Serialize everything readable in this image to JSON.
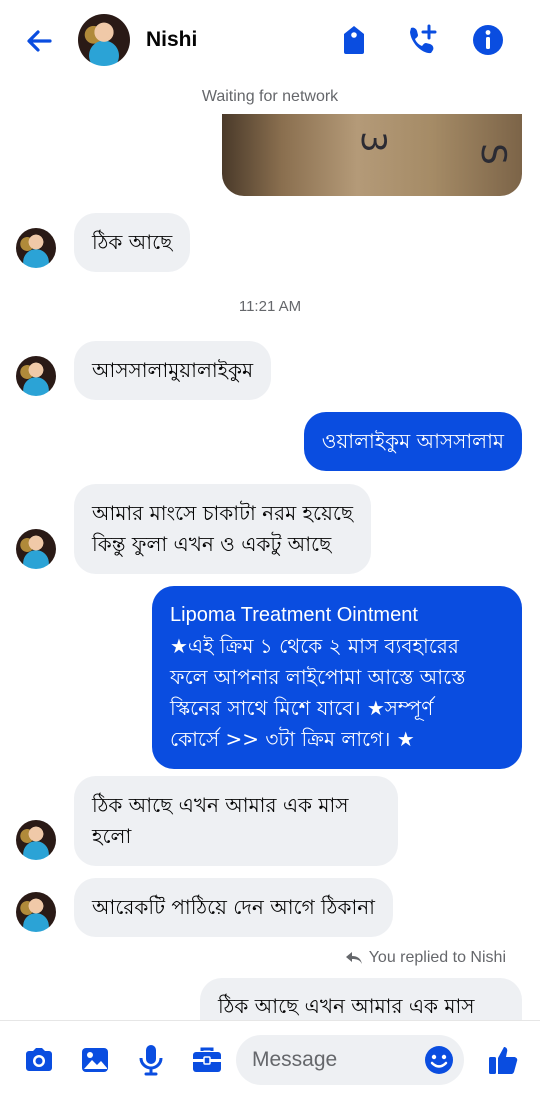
{
  "header": {
    "contact_name": "Nishi",
    "status": "Waiting for network",
    "icons": [
      "back-arrow-icon",
      "tag-icon",
      "video-call-add-icon",
      "info-icon"
    ]
  },
  "photo": {
    "marks": [
      "3",
      "S"
    ]
  },
  "messages": [
    {
      "from": "Nishi",
      "text": "ঠিক আছে"
    },
    {
      "from": "Nishi",
      "text": "আসসালামুয়ালাইকুম"
    },
    {
      "from": "me",
      "text": "ওয়ালাইকুম আসসালাম"
    },
    {
      "from": "Nishi",
      "line1": "আমার মাংসে চাকাটা নরম হয়েছে",
      "line2": "কিন্তু ফুলা এখন ও একটু আছে"
    },
    {
      "from": "me",
      "line1": "Lipoma Treatment Ointment",
      "line2": "★এই ক্রিম ১ থেকে ২ মাস ব্যবহারের",
      "line3": "ফলে আপনার লাইপোমা আস্তে আস্তে",
      "line4": "স্কিনের সাথে মিশে যাবে। ★সম্পূর্ণ",
      "line5": "কোর্সে >> ৩টা ক্রিম লাগে। ★"
    },
    {
      "from": "Nishi",
      "line1": "ঠিক আছে এখন আমার এক মাস",
      "line2": "হলো"
    },
    {
      "from": "Nishi",
      "text": "আরেকটি পাঠিয়ে দেন আগে ঠিকানা"
    }
  ],
  "timestamp": "11:21 AM",
  "reply": {
    "label": "You replied to Nishi",
    "preview": "ঠিক আছে এখন আমার এক মাস"
  },
  "composer": {
    "placeholder": "Message",
    "icons": [
      "camera-icon",
      "image-icon",
      "microphone-icon",
      "briefcase-icon",
      "emoji-icon",
      "like-icon"
    ]
  },
  "colors": {
    "accent": "#0a4de0",
    "incoming_bubble": "#eef0f3"
  }
}
